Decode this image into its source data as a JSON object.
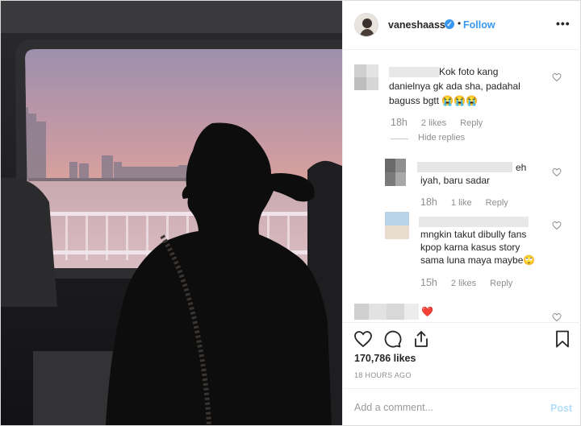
{
  "post": {
    "username": "vaneshaass",
    "follow_label": "Follow",
    "more_label": "•••",
    "verified_mark": "✓",
    "separator": "•"
  },
  "comments": [
    {
      "text_lines": [
        "Kok foto kang",
        "danielnya gk ada sha, padahal",
        "baguss bgtt 😭😭😭"
      ],
      "time": "18h",
      "likes": "2 likes",
      "reply": "Reply",
      "hide_replies": "Hide replies"
    },
    {
      "text_lines": [
        "eh",
        "iyah, baru sadar"
      ],
      "time": "18h",
      "likes": "1 like",
      "reply": "Reply"
    },
    {
      "text_lines": [
        "mngkin takut dibully fans",
        "kpop karna kasus story",
        "sama luna maya maybe🙄"
      ],
      "time": "15h",
      "likes": "2 likes",
      "reply": "Reply"
    },
    {
      "text_lines": [
        "❤️"
      ]
    }
  ],
  "icons": {
    "like": "heart-icon",
    "comment": "comment-icon",
    "share": "share-icon",
    "save": "bookmark-icon"
  },
  "likes_count": "170,786 likes",
  "posted_ago": "18 HOURS AGO",
  "add_comment": {
    "placeholder": "Add a comment...",
    "post_label": "Post"
  },
  "colors": {
    "accent": "#3897f0",
    "muted": "#8e8e8e",
    "post_disabled": "#b2dffc",
    "heart_emoji": "#e0245e"
  }
}
